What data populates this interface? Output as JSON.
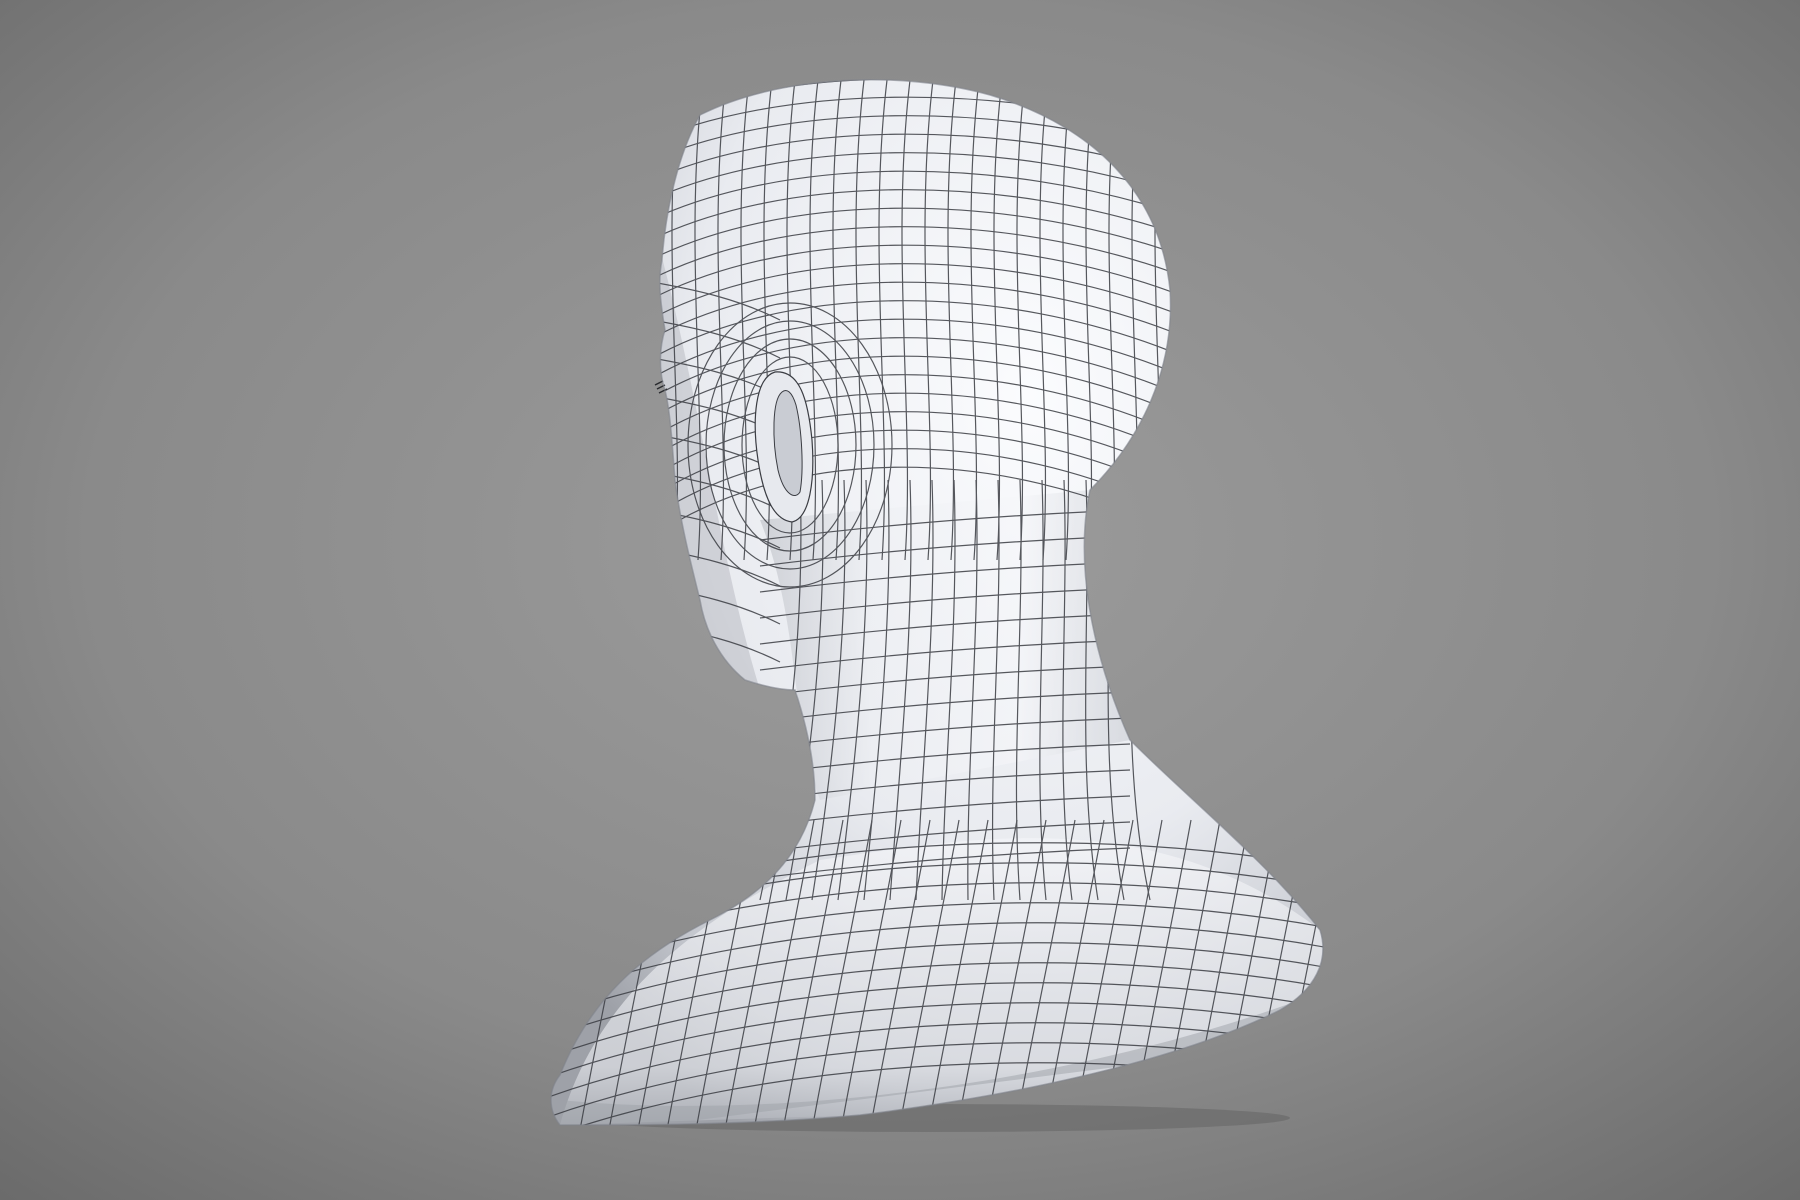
{
  "scene": {
    "subject": "bust-wireframe-render",
    "background_center": "#9a9a9a",
    "background_edge": "#6c6c6c",
    "surface_color": "#f2f3f6",
    "surface_shadow": "#a9abb2",
    "wire_color": "#3a3c42"
  }
}
